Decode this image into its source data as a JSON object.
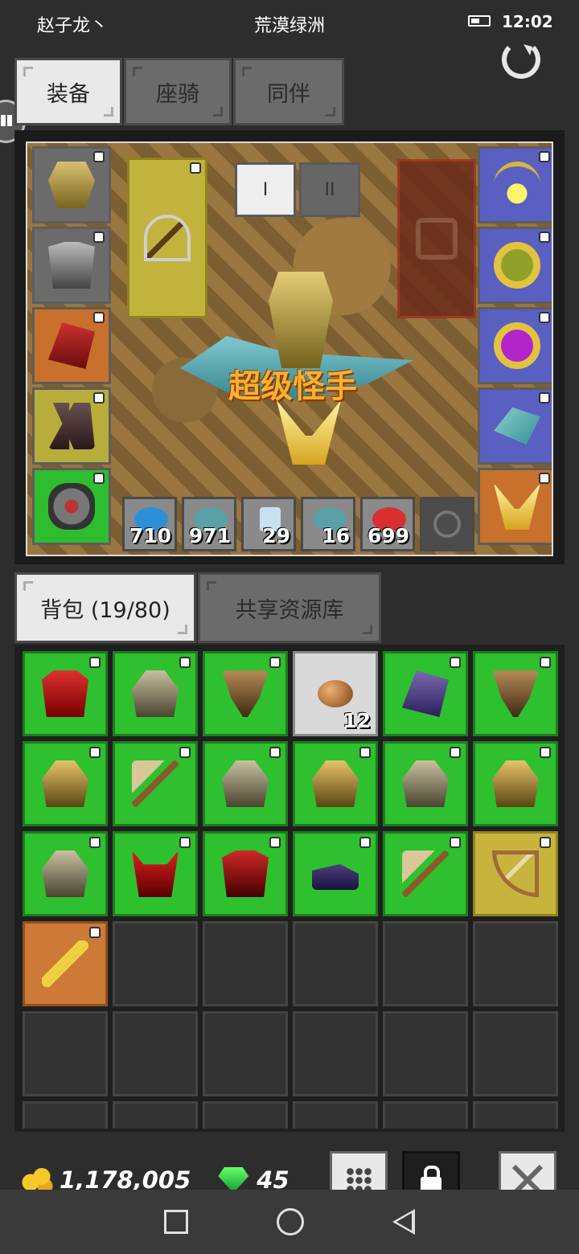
{
  "status_bar": {
    "player_name": "赵子龙丶",
    "zone_name": "荒漠绿洲",
    "time": "12:02",
    "icons": [
      "battery-icon"
    ]
  },
  "equip_tabs": [
    {
      "label": "装备",
      "active": true
    },
    {
      "label": "座骑",
      "active": false
    },
    {
      "label": "同伴",
      "active": false
    }
  ],
  "equipment": {
    "left_slots": [
      "helmet",
      "armor",
      "gloves",
      "boots",
      "accessory"
    ],
    "weapon_slot": "crossbow",
    "set_switch": [
      {
        "label": "I",
        "active": true
      },
      {
        "label": "II",
        "active": false
      }
    ],
    "right_slots": [
      "necklace",
      "ring",
      "ring",
      "mount",
      "wings"
    ],
    "hero_title": "超级怪手"
  },
  "quickbar": [
    {
      "item": "blue-fish",
      "count": "710"
    },
    {
      "item": "grey-fish",
      "count": "971"
    },
    {
      "item": "scroll",
      "count": "29"
    },
    {
      "item": "grey-fish",
      "count": "16"
    },
    {
      "item": "red-fish",
      "count": "699"
    }
  ],
  "bag_tabs": [
    {
      "label": "背包 (19/80)",
      "active": true
    },
    {
      "label": "共享资源库",
      "active": false
    }
  ],
  "bag": {
    "items": [
      {
        "icon": "vest",
        "rarity": "green",
        "count": ""
      },
      {
        "icon": "hood",
        "rarity": "green",
        "count": ""
      },
      {
        "icon": "mask",
        "rarity": "green",
        "count": ""
      },
      {
        "icon": "rock",
        "rarity": "white",
        "count": "12"
      },
      {
        "icon": "glove-purple",
        "rarity": "green",
        "count": ""
      },
      {
        "icon": "mask",
        "rarity": "green",
        "count": ""
      },
      {
        "icon": "hood-gold",
        "rarity": "green",
        "count": ""
      },
      {
        "icon": "axe",
        "rarity": "green",
        "count": ""
      },
      {
        "icon": "hood",
        "rarity": "green",
        "count": ""
      },
      {
        "icon": "hood-gold",
        "rarity": "green",
        "count": ""
      },
      {
        "icon": "hood",
        "rarity": "green",
        "count": ""
      },
      {
        "icon": "hood-gold",
        "rarity": "green",
        "count": ""
      },
      {
        "icon": "hood",
        "rarity": "green",
        "count": ""
      },
      {
        "icon": "horns",
        "rarity": "green",
        "count": ""
      },
      {
        "icon": "red-armor",
        "rarity": "green",
        "count": ""
      },
      {
        "icon": "shoe",
        "rarity": "green",
        "count": ""
      },
      {
        "icon": "axe",
        "rarity": "green",
        "count": ""
      },
      {
        "icon": "bow",
        "rarity": "yellow",
        "count": ""
      },
      {
        "icon": "sword",
        "rarity": "orange",
        "count": ""
      }
    ]
  },
  "currency": {
    "gold": "1,178,005",
    "gems": "45"
  }
}
